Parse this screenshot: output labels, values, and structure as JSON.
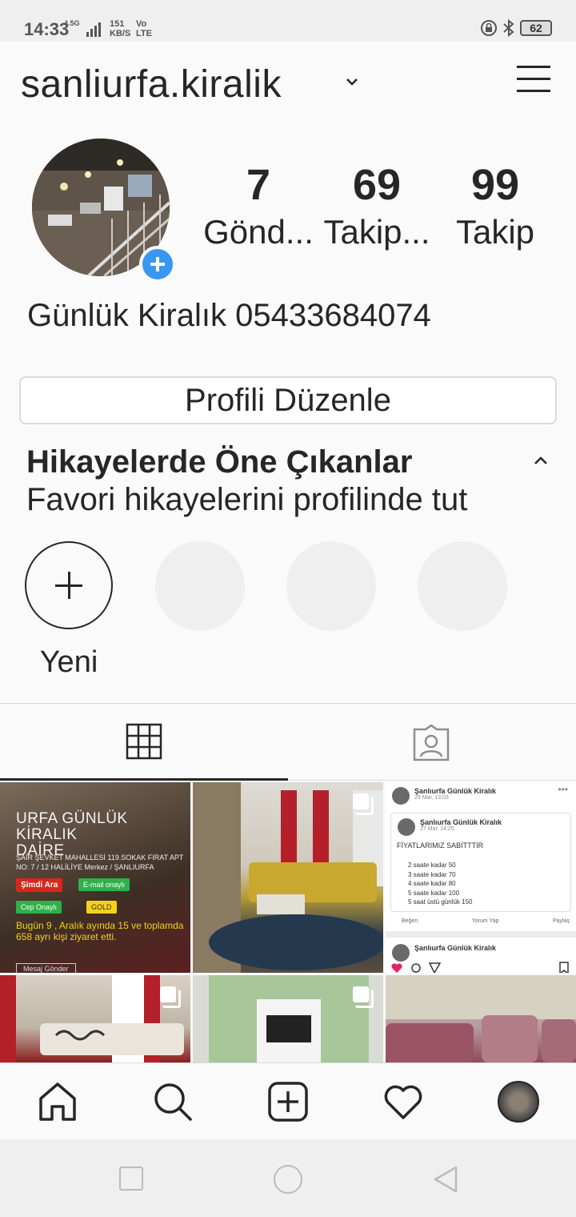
{
  "status_bar": {
    "time": "14:33",
    "network": "4.5G",
    "speed_value": "151",
    "speed_unit": "KB/S",
    "volte_top": "Vo",
    "volte_bottom": "LTE",
    "battery": "62"
  },
  "header": {
    "username": "sanliurfa.kiralik"
  },
  "profile": {
    "stats": [
      {
        "value": "7",
        "label": "Gönd..."
      },
      {
        "value": "69",
        "label": "Takip..."
      },
      {
        "value": "99",
        "label": "Takip"
      }
    ],
    "bio": "Günlük Kiralık 05433684074",
    "edit_button": "Profili Düzenle"
  },
  "highlights": {
    "title": "Hikayelerde Öne Çıkanlar",
    "subtitle": "Favori hikayelerini profilinde tut",
    "new_label": "Yeni"
  },
  "posts": {
    "post1": {
      "title_line1": "URFA GÜNLÜK KİRALIK",
      "title_line2": "DAİRE",
      "address": "ŞAİR ŞEVKET MAHALLESİ 119.SOKAK FIRAT APT NO: 7 / 12 HALİLİYE Merkez / ŞANLIURFA",
      "call_btn": "Şimdi Ara",
      "email_badge": "E-mail onaylı",
      "phone_badge": "Cep Onaylı",
      "gold_badge": "GOLD",
      "stats_text": "Bugün 9 , Aralık ayında 15 ve toplamda 658 ayrı kişi ziyaret etti.",
      "message_btn": "Mesaj Gönder"
    },
    "post3": {
      "page_name": "Şanlıurfa Günlük Kiralık",
      "date1": "29 Mar, 13:03",
      "inner_name": "Şanlıurfa Günlük Kiralık",
      "date2": "27 Mar, 14:25",
      "fixed": "FİYATLARIMIZ SABİTTTİR",
      "prices": [
        "2 saate kadar 50",
        "3 saate kadar 70",
        "4 saate kadar 80",
        "5 saate kadar 100",
        "5 saat üstü günlük 150"
      ],
      "like": "Beğen",
      "comment": "Yorum Yap",
      "share": "Paylaş",
      "page_name2": "Şanlıurfa Günlük Kiralık"
    }
  }
}
